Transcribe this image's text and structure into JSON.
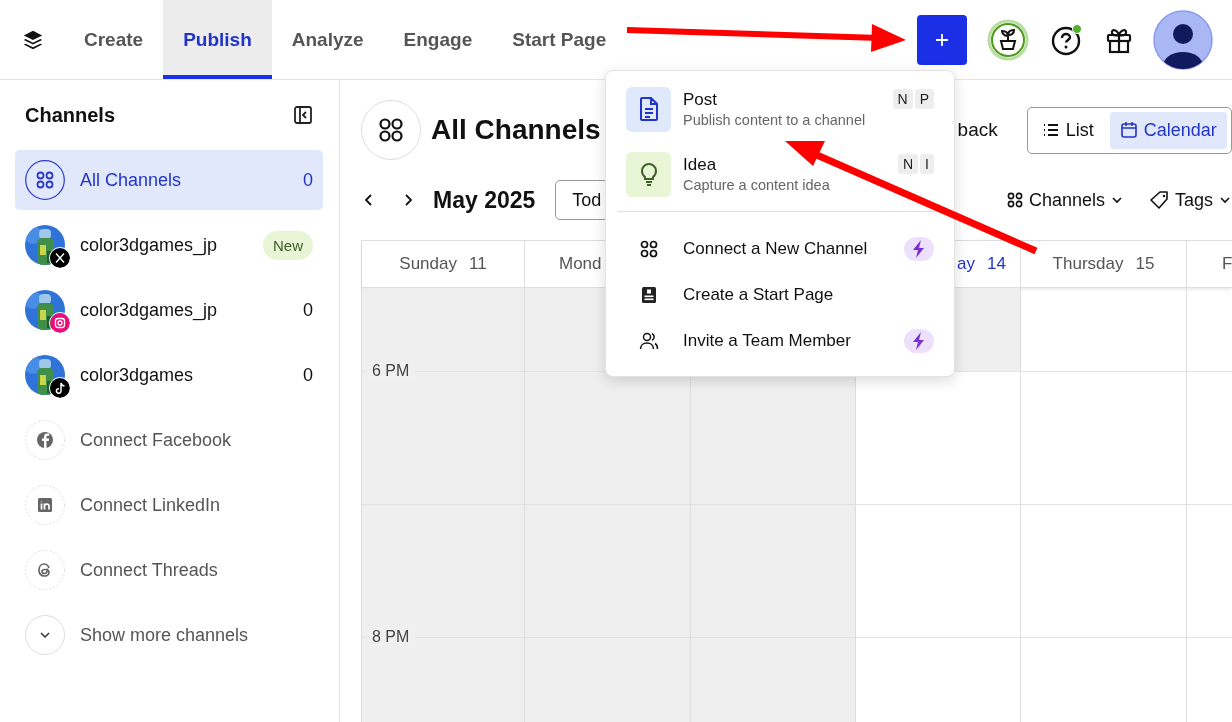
{
  "nav": {
    "tabs": [
      {
        "label": "Create",
        "selected": false
      },
      {
        "label": "Publish",
        "selected": true
      },
      {
        "label": "Analyze",
        "selected": false
      },
      {
        "label": "Engage",
        "selected": false
      },
      {
        "label": "Start Page",
        "selected": false
      }
    ],
    "help_notification": true
  },
  "sidebar": {
    "title": "Channels",
    "items": [
      {
        "kind": "all",
        "label": "All Channels",
        "count": "0",
        "selected": true
      },
      {
        "kind": "account",
        "label": "color3dgames_jp",
        "badge": "New",
        "selected": false
      },
      {
        "kind": "account",
        "label": "color3dgames_jp",
        "count": "0",
        "selected": false
      },
      {
        "kind": "account",
        "label": "color3dgames",
        "count": "0",
        "selected": false
      },
      {
        "kind": "connect",
        "label": "Connect Facebook",
        "selected": false
      },
      {
        "kind": "connect",
        "label": "Connect LinkedIn",
        "selected": false
      },
      {
        "kind": "connect",
        "label": "Connect Threads",
        "selected": false
      },
      {
        "kind": "more",
        "label": "Show more channels",
        "selected": false
      }
    ]
  },
  "main": {
    "title": "All Channels",
    "feedback": "back",
    "views": [
      {
        "label": "List",
        "selected": false
      },
      {
        "label": "Calendar",
        "selected": true
      }
    ],
    "month": "May 2025",
    "today_button": "Tod",
    "filters": [
      {
        "label": "Channels"
      },
      {
        "label": "Tags"
      }
    ]
  },
  "calendar": {
    "days": [
      {
        "name": "Sunday",
        "date": "11",
        "past": true
      },
      {
        "name": "Mond",
        "past": true
      },
      {
        "past": true
      },
      {
        "name": "ay",
        "date": "14",
        "past": false,
        "today": true
      },
      {
        "name": "Thursday",
        "date": "15",
        "past": false
      },
      {
        "name": "F",
        "past": false
      }
    ],
    "time_slots": [
      {
        "label": "6 PM"
      },
      {
        "label": "8 PM"
      }
    ]
  },
  "menu": {
    "items": [
      {
        "kind": "primary",
        "label": "Post",
        "description": "Publish content to a channel",
        "keys": [
          "N",
          "P"
        ]
      },
      {
        "kind": "primary",
        "label": "Idea",
        "description": "Capture a content idea",
        "keys": [
          "N",
          "I"
        ]
      },
      {
        "kind": "action",
        "label": "Connect a New Channel",
        "upgrade": true
      },
      {
        "kind": "action",
        "label": "Create a Start Page",
        "upgrade": false
      },
      {
        "kind": "action",
        "label": "Invite a Team Member",
        "upgrade": true
      }
    ]
  }
}
